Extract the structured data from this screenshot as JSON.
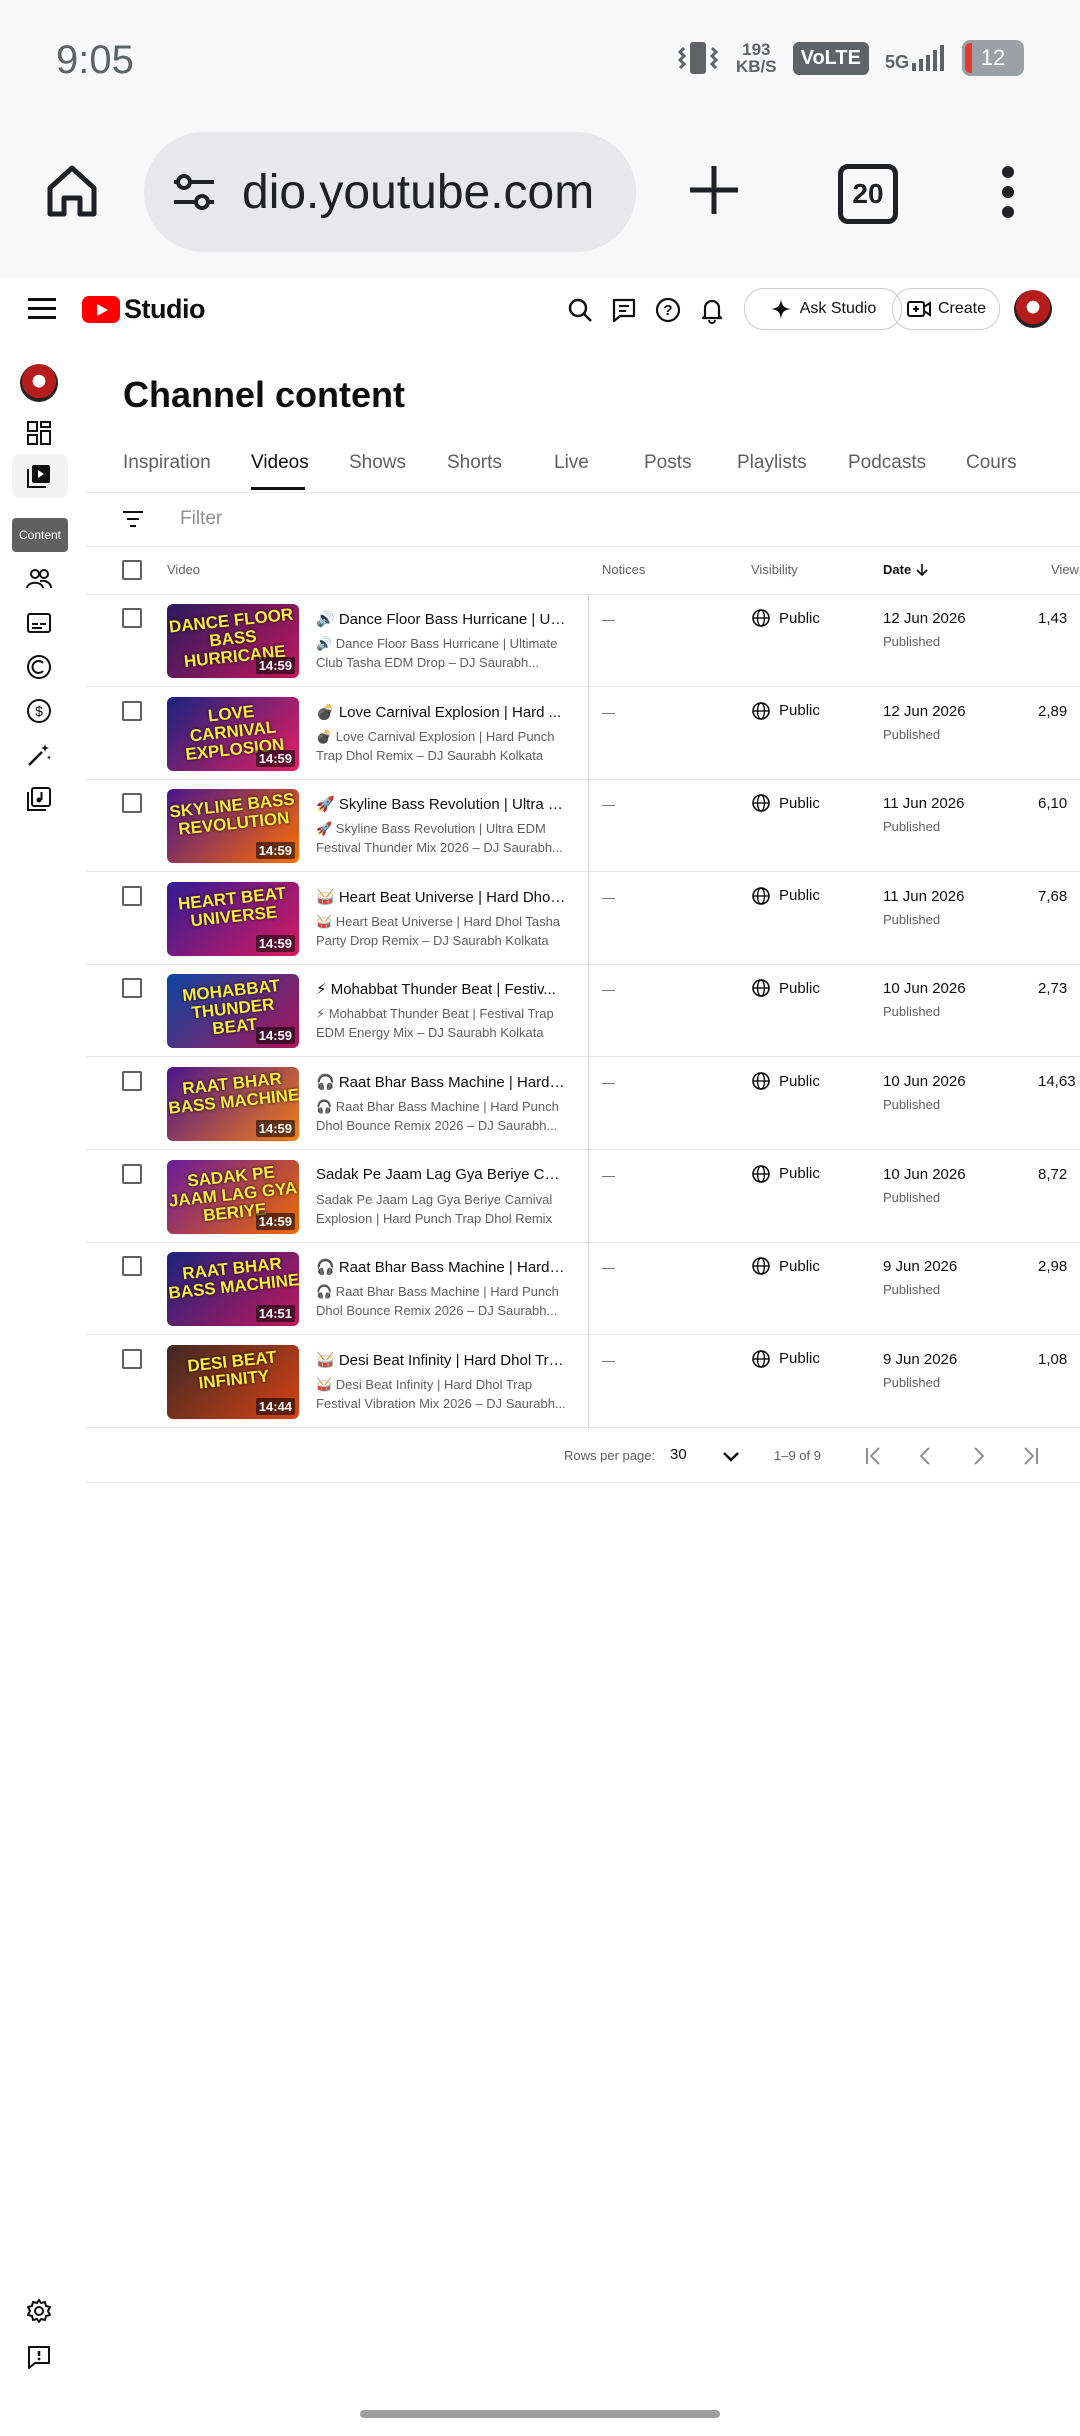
{
  "status_bar": {
    "time": "9:05",
    "speed_value": "193",
    "speed_unit": "KB/S",
    "volte": "VoLTE",
    "network": "5G",
    "battery": "12"
  },
  "browser": {
    "url": "dio.youtube.com",
    "tab_count": "20"
  },
  "studio": {
    "logo_text": "Studio",
    "ask_studio_label": "Ask Studio",
    "create_label": "Create",
    "tooltip": "Content",
    "page_title": "Channel content",
    "tabs": [
      "Inspiration",
      "Videos",
      "Shows",
      "Shorts",
      "Live",
      "Posts",
      "Playlists",
      "Podcasts",
      "Cours"
    ],
    "active_tab": "Videos",
    "filter_placeholder": "Filter",
    "columns": {
      "video": "Video",
      "notices": "Notices",
      "visibility": "Visibility",
      "date": "Date",
      "views": "View"
    }
  },
  "videos": [
    {
      "title": "🔊 Dance Floor Bass Hurricane | Ul...",
      "desc": "🔊 Dance Floor Bass Hurricane | Ultimate Club Tasha EDM Drop – DJ Saurabh...",
      "duration": "14:59",
      "notice": "—",
      "visibility": "Public",
      "date": "12 Jun 2026",
      "status": "Published",
      "views": "1,43",
      "thumb_text": "DANCE FLOOR BASS HURRICANE",
      "thumb_colors": [
        "#2a1a5e",
        "#c2185b"
      ]
    },
    {
      "title": "💣 Love Carnival Explosion | Hard ...",
      "desc": "💣 Love Carnival Explosion | Hard Punch Trap Dhol Remix – DJ Saurabh Kolkata",
      "duration": "14:59",
      "notice": "—",
      "visibility": "Public",
      "date": "12 Jun 2026",
      "status": "Published",
      "views": "2,89",
      "thumb_text": "LOVE CARNIVAL EXPLOSION",
      "thumb_colors": [
        "#1a237e",
        "#e91e63"
      ]
    },
    {
      "title": "🚀 Skyline Bass Revolution | Ultra E...",
      "desc": "🚀 Skyline Bass Revolution | Ultra EDM Festival Thunder Mix 2026 – DJ Saurabh...",
      "duration": "14:59",
      "notice": "—",
      "visibility": "Public",
      "date": "11 Jun 2026",
      "status": "Published",
      "views": "6,10",
      "thumb_text": "SKYLINE BASS REVOLUTION",
      "thumb_colors": [
        "#4a148c",
        "#ff6f00"
      ]
    },
    {
      "title": "🥁 Heart Beat Universe | Hard Dhol ...",
      "desc": "🥁 Heart Beat Universe | Hard Dhol Tasha Party Drop Remix – DJ Saurabh Kolkata",
      "duration": "14:59",
      "notice": "—",
      "visibility": "Public",
      "date": "11 Jun 2026",
      "status": "Published",
      "views": "7,68",
      "thumb_text": "HEART BEAT UNIVERSE",
      "thumb_colors": [
        "#311b92",
        "#d81b60"
      ]
    },
    {
      "title": "⚡ Mohabbat Thunder Beat | Festiv...",
      "desc": "⚡ Mohabbat Thunder Beat | Festival Trap EDM Energy Mix – DJ Saurabh Kolkata",
      "duration": "14:59",
      "notice": "—",
      "visibility": "Public",
      "date": "10 Jun 2026",
      "status": "Published",
      "views": "2,73",
      "thumb_text": "MOHABBAT THUNDER BEAT",
      "thumb_colors": [
        "#0d47a1",
        "#ad1457"
      ]
    },
    {
      "title": "🎧 Raat Bhar Bass Machine | Hard ...",
      "desc": "🎧 Raat Bhar Bass Machine | Hard Punch Dhol Bounce Remix 2026 – DJ Saurabh...",
      "duration": "14:59",
      "notice": "—",
      "visibility": "Public",
      "date": "10 Jun 2026",
      "status": "Published",
      "views": "14,63",
      "thumb_text": "RAAT BHAR BASS MACHINE",
      "thumb_colors": [
        "#4a148c",
        "#f57f17"
      ]
    },
    {
      "title": "Sadak Pe Jaam Lag Gya Beriye Car...",
      "desc": "Sadak Pe Jaam Lag Gya Beriye Carnival Explosion | Hard Punch Trap Dhol Remix ...",
      "duration": "14:59",
      "notice": "—",
      "visibility": "Public",
      "date": "10 Jun 2026",
      "status": "Published",
      "views": "8,72",
      "thumb_text": "SADAK PE JAAM LAG GYA BERIYE",
      "thumb_colors": [
        "#6a1b9a",
        "#ef6c00"
      ]
    },
    {
      "title": "🎧 Raat Bhar Bass Machine | Hard ...",
      "desc": "🎧 Raat Bhar Bass Machine | Hard Punch Dhol Bounce Remix 2026 – DJ Saurabh...",
      "duration": "14:51",
      "notice": "—",
      "visibility": "Public",
      "date": "9 Jun 2026",
      "status": "Published",
      "views": "2,98",
      "thumb_text": "RAAT BHAR BASS MACHINE",
      "thumb_colors": [
        "#1a237e",
        "#c2185b"
      ]
    },
    {
      "title": "🥁 Desi Beat Infinity | Hard Dhol Tra...",
      "desc": "🥁 Desi Beat Infinity | Hard Dhol Trap Festival Vibration Mix 2026 – DJ Saurabh...",
      "duration": "14:44",
      "notice": "—",
      "visibility": "Public",
      "date": "9 Jun 2026",
      "status": "Published",
      "views": "1,08",
      "thumb_text": "DESI BEAT INFINITY",
      "thumb_colors": [
        "#3e2723",
        "#d84315"
      ]
    }
  ],
  "pagination": {
    "rows_label": "Rows per page:",
    "rows_value": "30",
    "range": "1–9 of 9"
  }
}
